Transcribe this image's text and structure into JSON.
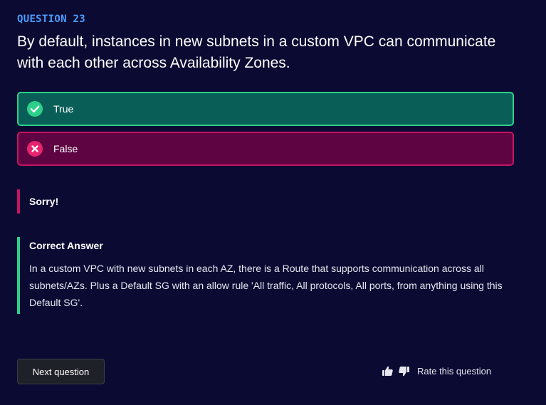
{
  "question": {
    "label": "QUESTION 23",
    "text": "By default, instances in new subnets in a custom VPC can communicate with each other across Availability Zones."
  },
  "options": [
    {
      "label": "True",
      "state": "correct",
      "icon": "check-circle-icon"
    },
    {
      "label": "False",
      "state": "wrong",
      "icon": "x-circle-icon"
    }
  ],
  "feedback": {
    "result_title": "Sorry!",
    "answer_title": "Correct Answer",
    "answer_text": "In a custom VPC with new subnets in each AZ, there is a Route that supports communication across all subnets/AZs. Plus a Default SG with an allow rule 'All traffic, All protocols, All ports, from anything using this Default SG'."
  },
  "actions": {
    "next_label": "Next question",
    "rate_label": "Rate this question"
  },
  "colors": {
    "background": "#0a0a32",
    "accent_blue": "#4a9eff",
    "correct_border": "#2ed089",
    "correct_bg": "#0a5e58",
    "wrong_border": "#c7145f",
    "wrong_bg": "#5e0442"
  }
}
